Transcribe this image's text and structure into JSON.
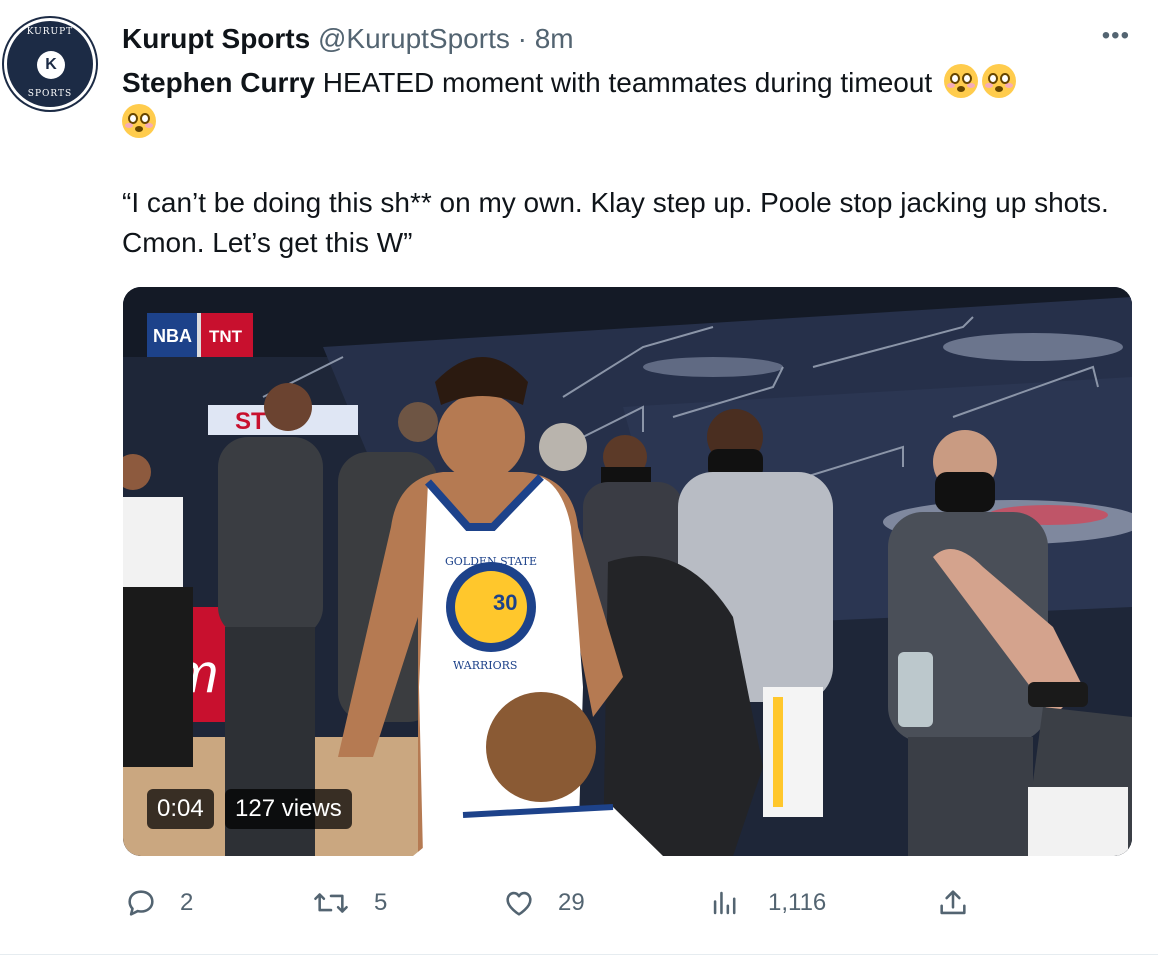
{
  "account": {
    "name": "Kurupt Sports",
    "handle": "@KuruptSports",
    "separator": " · ",
    "time": "8m",
    "avatar_top_text": "KURUPT",
    "avatar_bottom_text": "SPORTS",
    "avatar_letter": "K"
  },
  "more_icon": "more-horizontal-icon",
  "tweet": {
    "bold_name": "Stephen Curry",
    "headline": " HEATED moment with teammates during timeout",
    "emoji": "flushed-face-emoji",
    "quote": "“I can’t be doing this sh** on my own. Klay step up. Poole stop jacking up shots. Cmon. Let’s get this W”"
  },
  "media": {
    "duration": "0:04",
    "views": "127 views",
    "overlay_network": "NBA",
    "overlay_channel": "TNT",
    "jersey_number": "30",
    "jersey_text_top": "GOLDEN STATE",
    "jersey_text_bottom": "WARRIORS",
    "arena_sign": "rm",
    "scoreboard": "ST"
  },
  "actions": [
    {
      "icon": "reply-icon",
      "count": "2"
    },
    {
      "icon": "retweet-icon",
      "count": "5"
    },
    {
      "icon": "like-icon",
      "count": "29"
    },
    {
      "icon": "views-icon",
      "count": "1,116"
    },
    {
      "icon": "share-icon",
      "count": ""
    }
  ],
  "colors": {
    "text": "#0f1419",
    "secondary": "#536471",
    "avatar_bg": "#1c2b45",
    "warriors_blue": "#1d428a",
    "warriors_gold": "#ffc72c"
  }
}
